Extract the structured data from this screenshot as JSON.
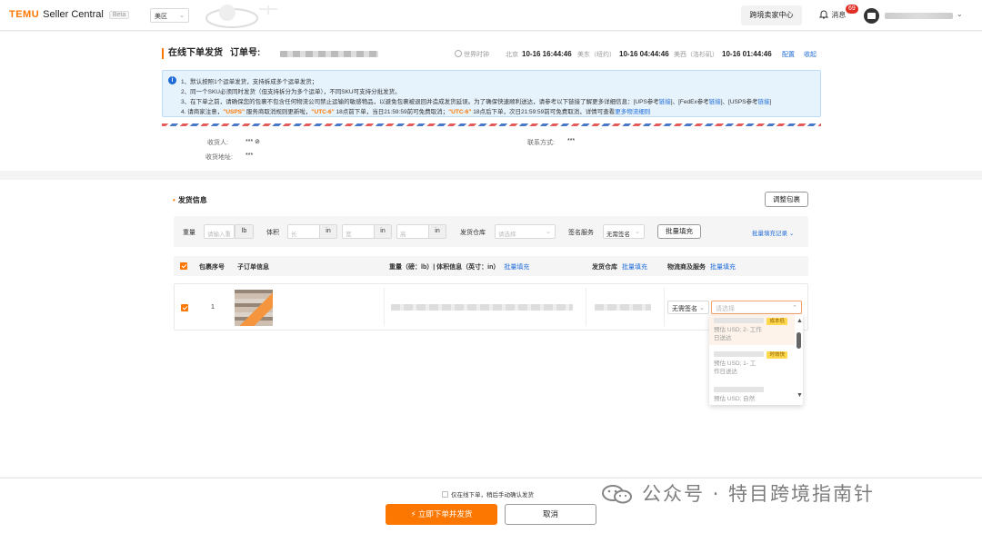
{
  "app": {
    "logo_brand": "TEMU",
    "logo_suffix": "Seller Central",
    "beta": "Beta",
    "region": "美区"
  },
  "topbar": {
    "crossborder_center": "跨境卖家中心",
    "messages_label": "消息",
    "messages_count": "69"
  },
  "page": {
    "title": "在线下单发货",
    "order_label": "订单号:",
    "world_clock": "世界时钟",
    "timezones": [
      {
        "city": "北京",
        "time": "10-16 16:44:46"
      },
      {
        "city": "美东（纽约）",
        "time": "10-16 04:44:46"
      },
      {
        "city": "美西（洛杉矶）",
        "time": "10-16 01:44:46"
      }
    ],
    "config_link": "配置",
    "collapse_link": "收起"
  },
  "notice": {
    "line1": "1、默认按照1个运单发货，支持拆成多个运单发货；",
    "line2": "2、同一个SKU必须同时发货（但支持拆分为多个运单），不同SKU可支持分批发货。",
    "line3_prefix": "3、在下单之前，请确保您的包裹不包含任何物流公司禁止运输的敏感物品，以避免包裹被退回并造成发货延误。为了确保快速顺利送达，请参考以下链接了解更多详细信息：[UPS参考",
    "line3_link1": "链接",
    "line3_mid1": "]、[FedEx参考",
    "line3_link2": "链接",
    "line3_mid2": "]、[USPS参考",
    "line3_link3": "链接",
    "line3_suffix": "]",
    "line4_prefix": "4. 请商家注意，",
    "line4_usps": "\"USPS\"",
    "line4_mid1": "服务商取消规则更新啦，",
    "line4_utc1": "\"UTC-6\"",
    "line4_mid2": "18点前下单，当日21:59:59前可免费取消；",
    "line4_utc2": "\"UTC-6\"",
    "line4_mid3": "18点后下单，次日21:59:59前可免费取消，详情可查看",
    "line4_link": "更多物流细则"
  },
  "address": {
    "recipient_label": "收货人:",
    "recipient_value": "*** ⊘",
    "contact_label": "联系方式:",
    "contact_value": "***",
    "address_label": "收货地址:",
    "address_value": "***"
  },
  "shipping": {
    "section_title": "发货信息",
    "adjust_button": "调整包裹",
    "filters": {
      "weight_label": "重量",
      "weight_placeholder": "请输入重",
      "weight_unit": "lb",
      "volume_label": "体积",
      "length_placeholder": "长",
      "width_placeholder": "宽",
      "height_placeholder": "高",
      "dim_unit": "in",
      "warehouse_label": "发货仓库",
      "warehouse_placeholder": "请选择",
      "signature_label": "签名服务",
      "signature_value": "无需签名",
      "batch_fill_button": "批量填充",
      "batch_record_link": "批量填充记录"
    },
    "table": {
      "headers": {
        "package_no": "包裹序号",
        "sub_order": "子订单信息",
        "weight_volume": "重量（磅：lb）| 体积信息（英寸：in）",
        "warehouse": "发货仓库",
        "logistics": "物流商及服务",
        "batch_fill": "批量填充"
      },
      "rows": [
        {
          "package_no": "1",
          "signature": "无需签名",
          "logistics_placeholder": "请选择"
        }
      ]
    },
    "dropdown": {
      "options": [
        {
          "tag": "成本低",
          "desc_a": "预估",
          "desc_b": "USD; 2-",
          "desc_c": "工作",
          "desc_d": "日送达"
        },
        {
          "tag": "时效快",
          "desc_a": "预估",
          "desc_b": "USD; 1-",
          "desc_c": "工",
          "desc_d": "作日送达"
        },
        {
          "tag": "",
          "desc_a": "预估",
          "desc_b": "USD;",
          "desc_c": "自然",
          "desc_d": ""
        }
      ]
    }
  },
  "footer": {
    "checkbox_label": "仅在线下单，稍后手动确认发货",
    "submit_button": "立即下单并发货",
    "cancel_button": "取消"
  },
  "watermark": {
    "text": "公众号 · 特目跨境指南针"
  }
}
